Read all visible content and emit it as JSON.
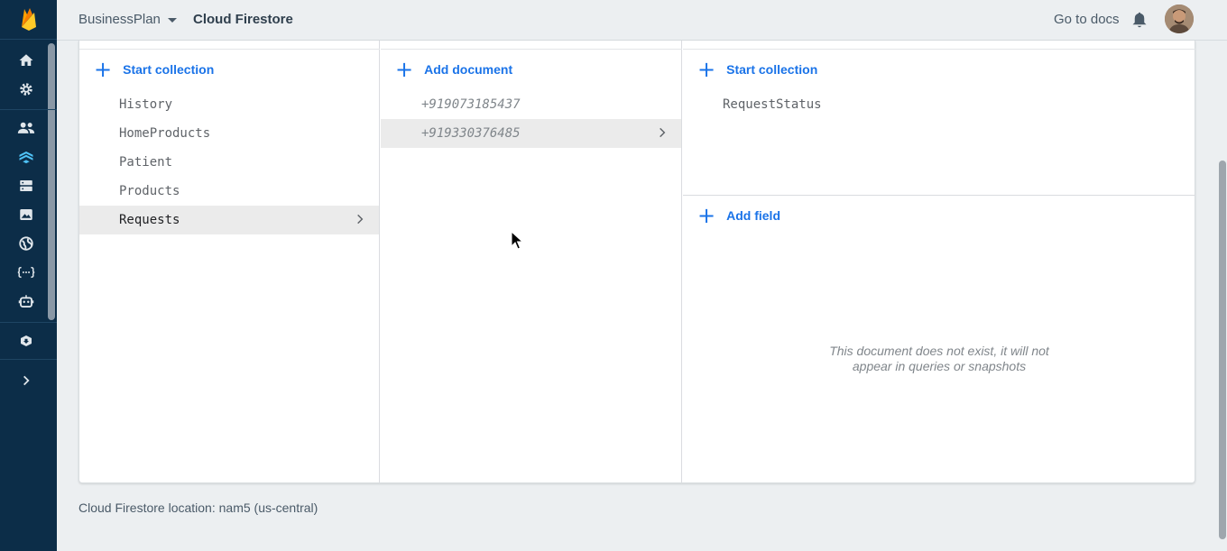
{
  "topbar": {
    "project_name": "BusinessPlan",
    "product_name": "Cloud Firestore",
    "docs_link": "Go to docs"
  },
  "rail": {
    "icons": [
      "firebase-logo",
      "home-icon",
      "settings-icon",
      "people-icon",
      "firestore-icon",
      "database-icon",
      "image-icon",
      "globe-icon",
      "functions-icon",
      "robot-icon",
      "extensions-icon",
      "expand-icon"
    ]
  },
  "collections": {
    "start_label": "Start collection",
    "items": [
      "History",
      "HomeProducts",
      "Patient",
      "Products",
      "Requests"
    ],
    "selected": "Requests"
  },
  "documents": {
    "add_label": "Add document",
    "items": [
      "+919073185437",
      "+919330376485"
    ],
    "selected": "+919330376485"
  },
  "document_detail": {
    "start_collection_label": "Start collection",
    "subcollections": [
      "RequestStatus"
    ],
    "add_field_label": "Add field",
    "missing_message_line1": "This document does not exist, it will not",
    "missing_message_line2": "appear in queries or snapshots"
  },
  "footer": {
    "location_text": "Cloud Firestore location: nam5 (us-central)"
  },
  "colors": {
    "rail_bg": "#0c2d48",
    "accent": "#1a73e8",
    "logo_yellow": "#ffca28",
    "logo_orange": "#f57c00"
  }
}
